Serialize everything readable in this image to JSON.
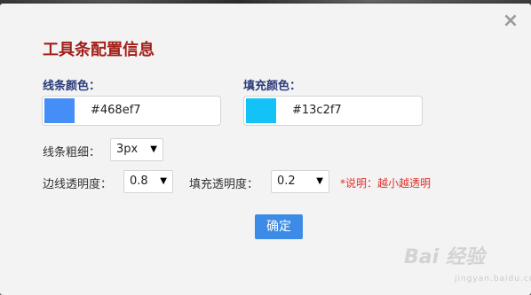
{
  "dialog": {
    "title": "工具条配置信息",
    "close_icon": "close-icon"
  },
  "line_color": {
    "label": "线条颜色：",
    "value": "#468ef7",
    "swatch_color": "#468ef7"
  },
  "fill_color": {
    "label": "填充颜色：",
    "value": "#13c2f7",
    "swatch_color": "#13c2f7"
  },
  "line_width": {
    "label": "线条粗细：",
    "selected": "3px"
  },
  "border_opacity": {
    "label": "边线透明度：",
    "selected": "0.8"
  },
  "fill_opacity": {
    "label": "填充透明度：",
    "selected": "0.2"
  },
  "note": "*说明：越小越透明",
  "confirm_label": "确定",
  "watermark": {
    "text": "Bai 经验",
    "sub": "jingyan.baidu.com"
  }
}
